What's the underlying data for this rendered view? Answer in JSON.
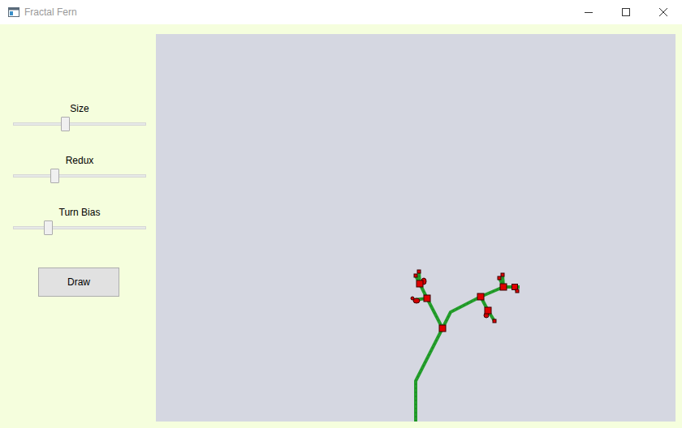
{
  "window": {
    "title": "Fractal Fern"
  },
  "sliders": [
    {
      "label": "Size",
      "level": 0.39
    },
    {
      "label": "Redux",
      "level": 0.31
    },
    {
      "label": "Turn Bias",
      "level": 0.26
    }
  ],
  "buttons": [
    "Draw"
  ]
}
